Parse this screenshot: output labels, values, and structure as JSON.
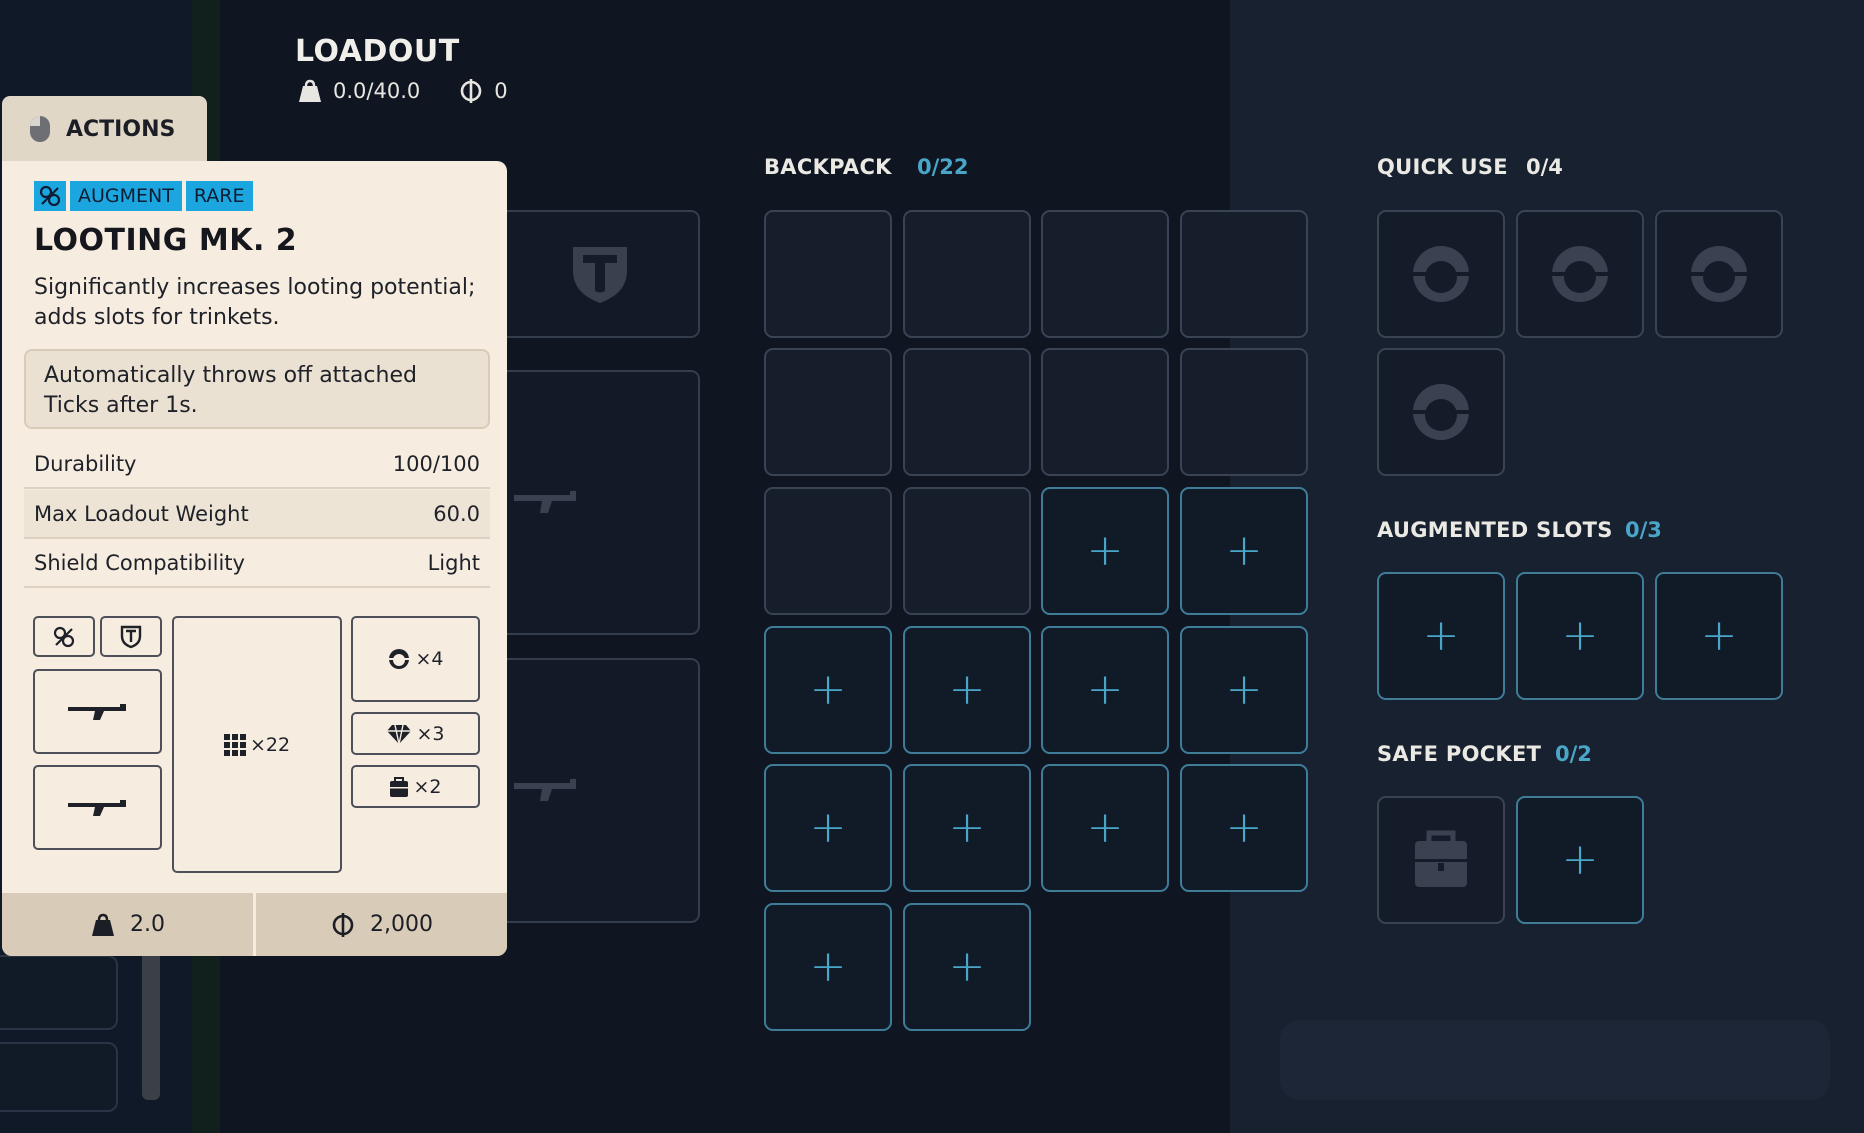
{
  "header": {
    "title": "LOADOUT",
    "weight": "0.0/40.0",
    "currency": "0"
  },
  "backpack": {
    "label": "BACKPACK",
    "count": "0/22"
  },
  "quick_use": {
    "label": "QUICK USE",
    "count": "0/4"
  },
  "augmented_slots": {
    "label": "AUGMENTED SLOTS",
    "count": "0/3"
  },
  "safe_pocket": {
    "label": "SAFE POCKET",
    "count": "0/2"
  },
  "actions_tab": {
    "label": "ACTIONS"
  },
  "tooltip": {
    "tags": [
      "AUGMENT",
      "RARE"
    ],
    "name": "LOOTING MK. 2",
    "description": "Significantly increases looting potential; adds slots for trinkets.",
    "effect": "Automatically throws off attached Ticks after 1s.",
    "stats": [
      {
        "label": "Durability",
        "value": "100/100"
      },
      {
        "label": "Max Loadout Weight",
        "value": "60.0"
      },
      {
        "label": "Shield Compatibility",
        "value": "Light"
      }
    ],
    "slot_summary": {
      "backpack_slots": "×22",
      "quick_use_slots": "×4",
      "trinket_slots": "×3",
      "safe_pocket_slots": "×2"
    },
    "footer": {
      "weight": "2.0",
      "price": "2,000"
    }
  },
  "colors": {
    "accent": "#4aa6c9",
    "tag": "#1ba6e0",
    "tooltip_bg": "#f6ece0",
    "background": "#0f1622"
  }
}
